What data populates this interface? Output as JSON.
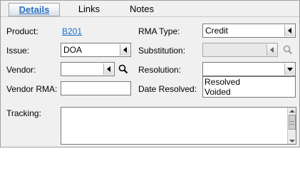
{
  "tabs": [
    {
      "label": "Details",
      "active": true
    },
    {
      "label": "Links",
      "active": false
    },
    {
      "label": "Notes",
      "active": false
    }
  ],
  "form": {
    "product": {
      "label": "Product:",
      "value": "B201"
    },
    "issue": {
      "label": "Issue:",
      "value": "DOA"
    },
    "vendor": {
      "label": "Vendor:",
      "value": ""
    },
    "vendor_rma": {
      "label": "Vendor RMA:",
      "value": ""
    },
    "rma_type": {
      "label": "RMA Type:",
      "value": "Credit"
    },
    "substitution": {
      "label": "Substitution:",
      "value": ""
    },
    "resolution": {
      "label": "Resolution:",
      "value": "",
      "options": [
        "Resolved",
        "Voided"
      ]
    },
    "date_resolved": {
      "label": "Date Resolved:"
    },
    "tracking": {
      "label": "Tracking:",
      "value": ""
    }
  },
  "icons": {
    "search": "search-icon",
    "dropdown": "chevron-down-icon",
    "picker": "chevron-left-icon"
  },
  "colors": {
    "link": "#1a6ec0",
    "active_tab_text": "#2a6fc2"
  }
}
